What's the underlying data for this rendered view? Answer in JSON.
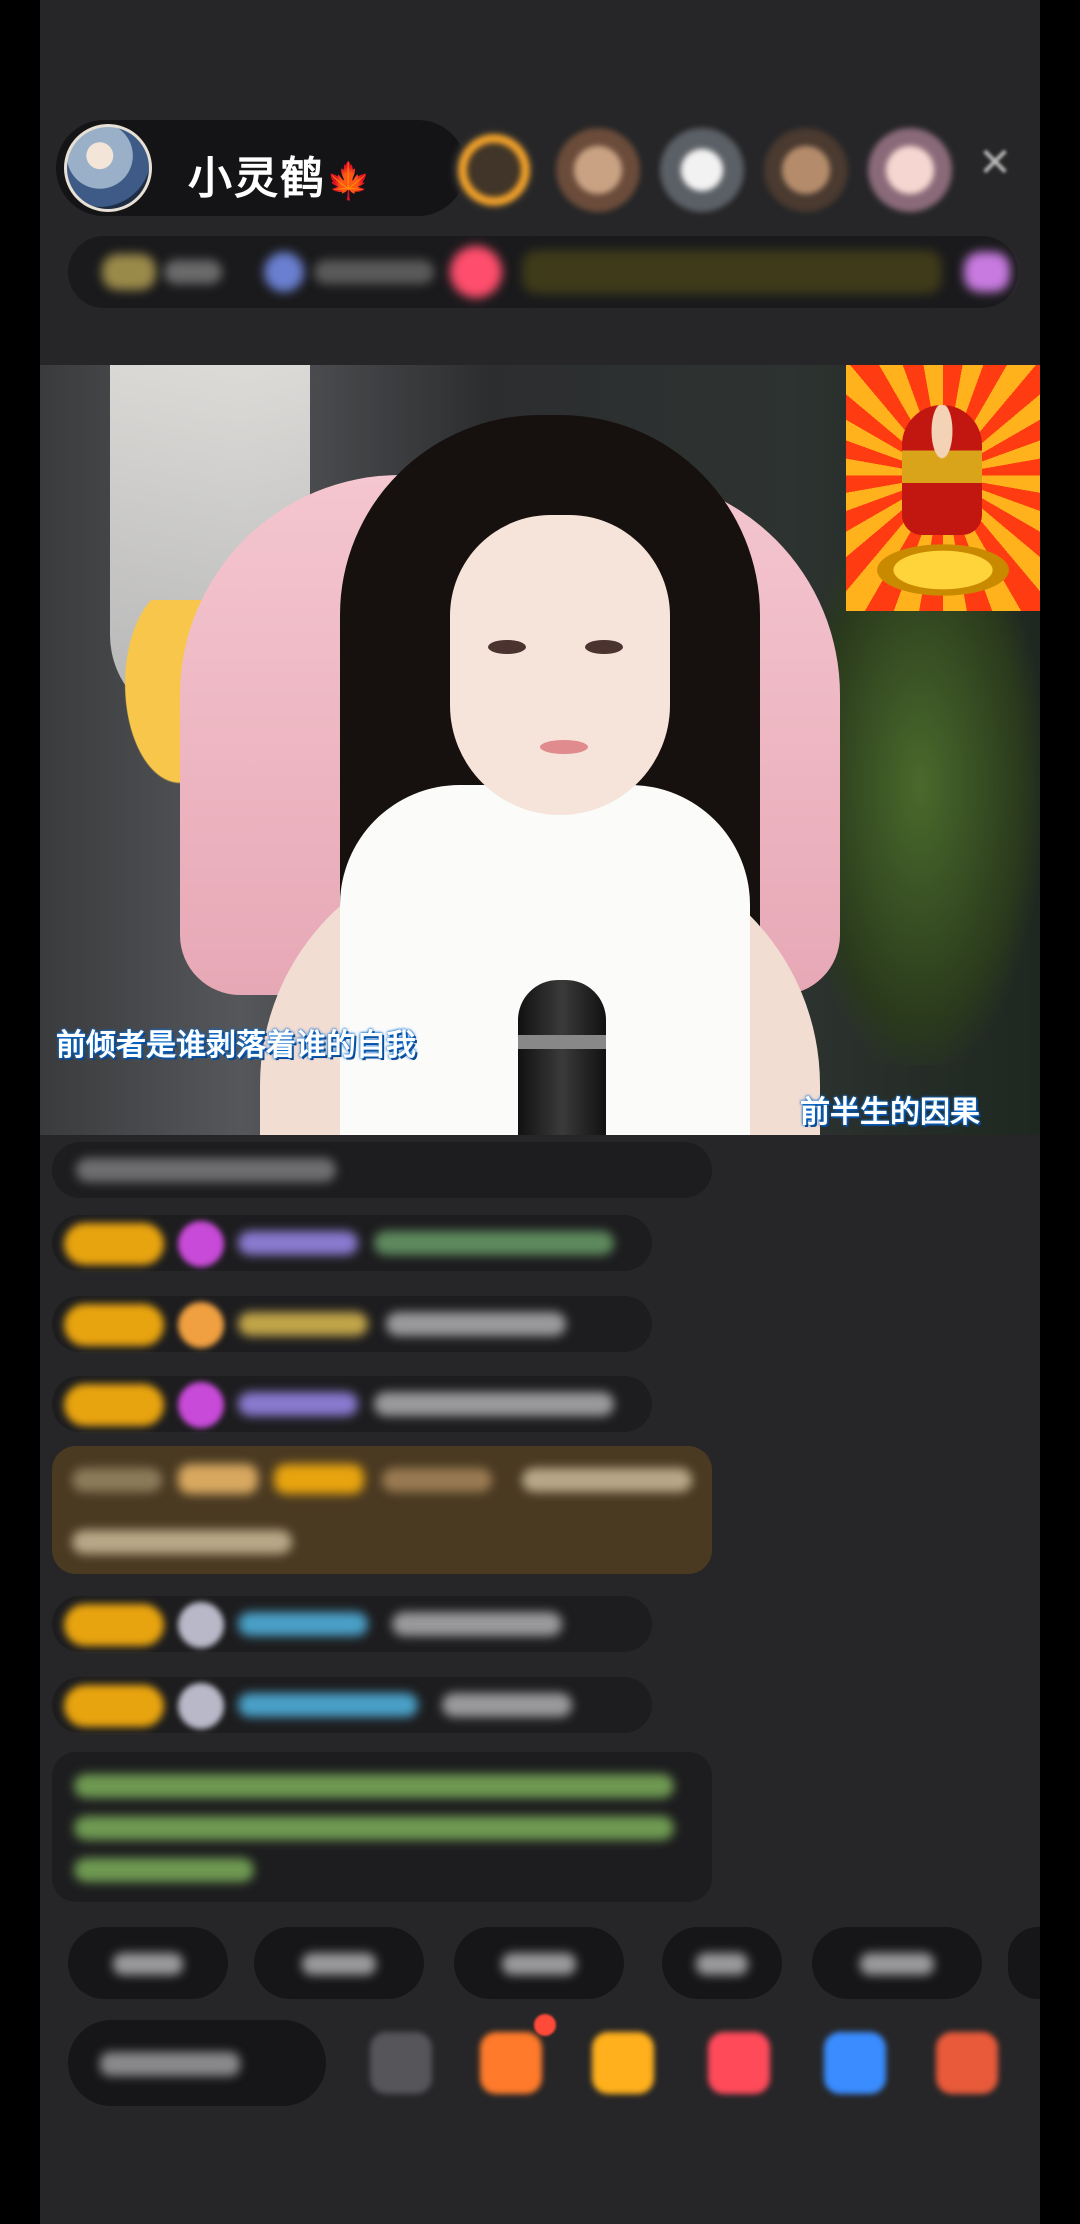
{
  "header": {
    "host_name": "小灵鹤",
    "host_name_emoji": "🍁",
    "close_icon": "close-icon"
  },
  "video": {
    "lyrics_left": "前倾者是谁剥落着谁的自我",
    "lyrics_right": "前半生的因果"
  },
  "colors": {
    "background": "#262628",
    "pill": "#141416",
    "level_badge": "#e8a40f",
    "lyric_glow": "#0d6fd1"
  }
}
